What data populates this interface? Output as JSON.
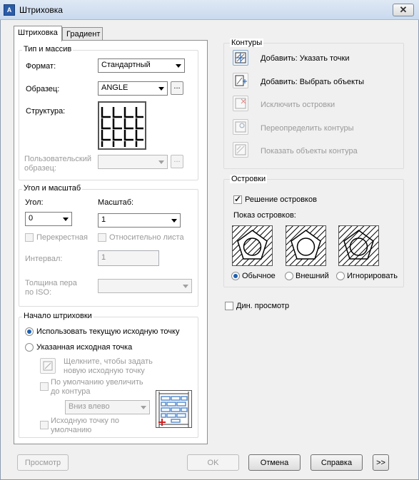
{
  "window": {
    "title": "Штриховка",
    "close": "✕",
    "app_icon": "autocad-icon"
  },
  "tabs": [
    {
      "label": "Штриховка",
      "active": true
    },
    {
      "label": "Градиент",
      "active": false
    }
  ],
  "type_pattern": {
    "title": "Тип и массив",
    "format_label": "Формат:",
    "format_value": "Стандартный",
    "sample_label": "Образец:",
    "sample_value": "ANGLE",
    "sample_ellipsis": "...",
    "structure_label": "Структура:",
    "custom_label_1": "Пользовательский",
    "custom_label_2": "образец:",
    "custom_ellipsis": "..."
  },
  "angle_scale": {
    "title": "Угол и масштаб",
    "angle_label": "Угол:",
    "angle_value": "0",
    "scale_label": "Масштаб:",
    "scale_value": "1",
    "crossed_label": "Перекрестная",
    "relative_label": "Относительно листа",
    "interval_label": "Интервал:",
    "interval_value": "1",
    "pen_label_1": "Толщина пера",
    "pen_label_2": "по ISO:"
  },
  "origin": {
    "title": "Начало штриховки",
    "use_current": "Использовать текущую исходную точку",
    "specified": "Указанная исходная точка",
    "click_set_1": "Щелкните, чтобы задать",
    "click_set_2": "новую исходную точку",
    "default_extents_1": "По умолчанию увеличить",
    "default_extents_2": "до контура",
    "position_value": "Вниз влево",
    "store_default_1": "Исходную точку по",
    "store_default_2": "умолчанию"
  },
  "boundaries": {
    "title": "Контуры",
    "add_pick": "Добавить: Указать точки",
    "add_select": "Добавить: Выбрать объекты",
    "remove_islands": "Исключить островки",
    "recreate": "Переопределить контуры",
    "view_selection": "Показать объекты контура"
  },
  "islands": {
    "title": "Островки",
    "detection": "Решение островков",
    "display_label": "Показ островков:",
    "normal": "Обычное",
    "outer": "Внешний",
    "ignore": "Игнорировать"
  },
  "dyn_preview": "Дин. просмотр",
  "buttons": {
    "preview": "Просмотр",
    "ok": "OK",
    "cancel": "Отмена",
    "help": "Справка",
    "more": ">>"
  },
  "colors": {
    "accent": "#1c5fb1",
    "disabled_text": "#9a9a9a",
    "titlebar": "#c9d9ee"
  }
}
